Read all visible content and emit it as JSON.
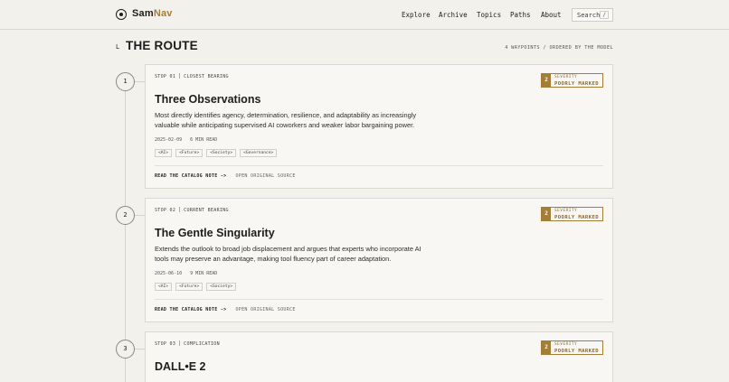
{
  "brand": {
    "part1": "Sam",
    "part2": "Nav"
  },
  "nav": [
    "Explore",
    "Archive",
    "Topics",
    "Paths",
    "About"
  ],
  "search": {
    "label": "Search",
    "key": "/"
  },
  "page": {
    "marker": "L",
    "title": "THE ROUTE",
    "meta": "4 WAYPOINTS / ORDERED BY THE MODEL"
  },
  "cards": [
    {
      "node": "1",
      "stop": "STOP 01",
      "bearing": "CLOSEST BEARING",
      "severity_num": "2",
      "severity_label": "SEVERITY",
      "severity_value": "POORLY MARKED",
      "title": "Three Observations",
      "description": "Most directly identifies agency, determination, resilience, and adaptability as increasingly valuable while anticipating supervised AI coworkers and weaker labor bargaining power.",
      "date": "2025-02-09",
      "read": "6 MIN READ",
      "tags": [
        "<AI>",
        "<Future>",
        "<Society>",
        "<Governance>"
      ],
      "link_primary": "READ THE CATALOG NOTE ->",
      "link_secondary": "OPEN ORIGINAL SOURCE"
    },
    {
      "node": "2",
      "stop": "STOP 02",
      "bearing": "CURRENT BEARING",
      "severity_num": "2",
      "severity_label": "SEVERITY",
      "severity_value": "POORLY MARKED",
      "title": "The Gentle Singularity",
      "description": "Extends the outlook to broad job displacement and argues that experts who incorporate AI tools may preserve an advantage, making tool fluency part of career adaptation.",
      "date": "2025-06-10",
      "read": "9 MIN READ",
      "tags": [
        "<AI>",
        "<Future>",
        "<Society>"
      ],
      "link_primary": "READ THE CATALOG NOTE ->",
      "link_secondary": "OPEN ORIGINAL SOURCE"
    },
    {
      "node": "3",
      "stop": "STOP 03",
      "bearing": "COMPLICATION",
      "severity_num": "2",
      "severity_label": "SEVERITY",
      "severity_value": "POORLY MARKED",
      "title": "DALL•E 2"
    }
  ]
}
